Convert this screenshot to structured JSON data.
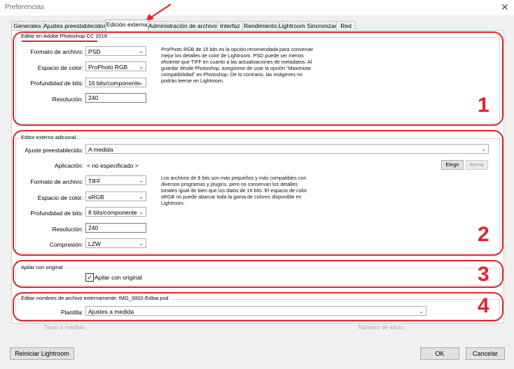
{
  "window": {
    "title": "Preferencias",
    "close": "✕"
  },
  "tabs": [
    {
      "label": "Generales"
    },
    {
      "label": "Ajustes preestablecidos"
    },
    {
      "label": "Edición externa"
    },
    {
      "label": "Administración de archivos"
    },
    {
      "label": "Interfaz"
    },
    {
      "label": "Rendimiento"
    },
    {
      "label": "Lightroom Sincronizar"
    },
    {
      "label": "Red"
    }
  ],
  "photoshop": {
    "legend": "Editar en Adobe Photoshop CC 2018",
    "format_label": "Formato de archivo:",
    "format_value": "PSD",
    "color_label": "Espacio de color:",
    "color_value": "ProPhoto RGB",
    "depth_label": "Profundidad de bits:",
    "depth_value": "16 bits/componente",
    "res_label": "Resolución:",
    "res_value": "240",
    "info": "ProPhoto RGB de 16 bits es la opción recomendada para conservar mejor los detalles de color de Lightroom. PSD puede ser menos eficiente que TIFF en cuanto a las actualizaciones de metadatos. Al guardar desde Photoshop, asegúrese de usar la opción \"Maximizar compatibilidad\" en Photoshop. De lo contrario, las imágenes no podrán leerse en Lightroom."
  },
  "additional": {
    "legend": "Editor externo adicional",
    "preset_label": "Ajuste preestablecido:",
    "preset_value": "A medida",
    "app_label": "Aplicación:",
    "app_value": "< no especificado >",
    "choose": "Elegir",
    "clear": "Borrar",
    "format_label": "Formato de archivo:",
    "format_value": "TIFF",
    "color_label": "Espacio de color:",
    "color_value": "sRGB",
    "depth_label": "Profundidad de bits:",
    "depth_value": "8 bits/componente",
    "res_label": "Resolución:",
    "res_value": "240",
    "comp_label": "Compresión:",
    "comp_value": "LZW",
    "info": "Los archivos de 8 bits son más pequeños y más compatibles con diversos programas y plugins, pero no conservan los detalles tonales igual de bien que los datos de 16 bits. El espacio de color sRGB no puede abarcar toda la gama de colores disponible en Lightroom."
  },
  "stack": {
    "legend": "Apilar con original",
    "check_label": "Apilar con original",
    "checked": "✓"
  },
  "naming": {
    "legend": "Editar nombres de archivo externamente: IMG_0002-Editar.psd",
    "template_label": "Plantilla:",
    "template_value": "Ajustes a medida",
    "custom_text_label": "Texto a medida:",
    "start_number_label": "Número de inicio:"
  },
  "annotations": [
    "1",
    "2",
    "3",
    "4"
  ],
  "footer": {
    "reset": "Reiniciar Lightroom",
    "ok": "OK",
    "cancel": "Cancelar"
  },
  "colors": {
    "annotation": "#e0242b"
  }
}
